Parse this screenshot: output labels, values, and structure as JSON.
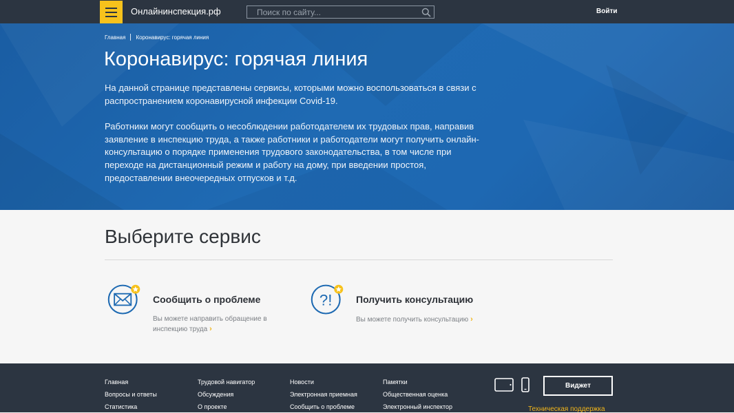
{
  "header": {
    "site_name": "Онлайнинспекция.рф",
    "search_placeholder": "Поиск по сайту...",
    "login_label": "Войти"
  },
  "breadcrumb": {
    "home": "Главная",
    "current": "Коронавирус: горячая линия"
  },
  "hero": {
    "title": "Коронавирус: горячая линия",
    "paragraph1": "На данной странице представлены сервисы, которыми можно воспользоваться в связи с распространением коронавирусной инфекции Covid-19.",
    "paragraph2": "Работники могут сообщить о несоблюдении работодателем их трудовых прав, направив заявление в инспекцию труда, а также работники и работодатели могут получить онлайн-консультацию о порядке применения трудового законодательства, в том числе при переходе на дистанционный режим и работу на дому, при введении простоя, предоставлении внеочередных отпусков и т.д."
  },
  "main": {
    "title": "Выберите сервис",
    "services": [
      {
        "title": "Сообщить о проблеме",
        "description": "Вы можете направить обращение в инспекцию труда",
        "icon": "envelope-icon"
      },
      {
        "title": "Получить консультацию",
        "description": "Вы можете получить консультацию",
        "icon": "question-exclamation-icon"
      }
    ]
  },
  "footer": {
    "col1": [
      "Главная",
      "Вопросы и ответы",
      "Статистика"
    ],
    "col2": [
      "Трудовой навигатор",
      "Обсуждения",
      "О проекте"
    ],
    "col3": [
      "Новости",
      "Электронная приемная",
      "Сообщить о проблеме"
    ],
    "col4": [
      "Памятки",
      "Общественная оценка",
      "Электронный инспектор"
    ],
    "widget_label": "Виджет",
    "support_label": "Техническая поддержка"
  },
  "colors": {
    "accent": "#f7c21c",
    "header_bg": "#2c3541",
    "hero_blue": "#1e68b2"
  }
}
